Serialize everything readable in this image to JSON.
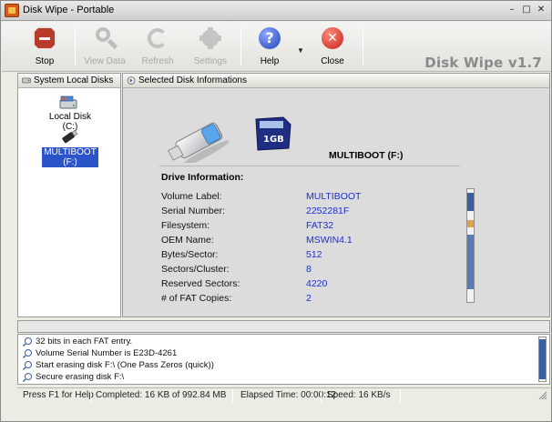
{
  "window": {
    "title": "Disk Wipe  - Portable",
    "controls": [
      "–",
      "□",
      "✕"
    ]
  },
  "toolbar": {
    "buttons": [
      {
        "label": "Stop",
        "icon": "stop-icon",
        "enabled": true
      },
      {
        "label": "View Data",
        "icon": "magnifier-icon",
        "enabled": false
      },
      {
        "label": "Refresh",
        "icon": "refresh-icon",
        "enabled": false
      },
      {
        "label": "Settings",
        "icon": "gear-icon",
        "enabled": false
      },
      {
        "label": "Help",
        "icon": "help-icon",
        "enabled": true
      },
      {
        "label": "Close",
        "icon": "close-icon",
        "enabled": true
      }
    ],
    "dropdown_glyph": "▼",
    "brand": "Disk Wipe v1.7"
  },
  "left_panel": {
    "header": "System Local Disks",
    "disks": [
      {
        "label": "Local Disk (C:)",
        "icon": "hard-drive-icon",
        "selected": false
      },
      {
        "label": "MULTIBOOT (F:)",
        "icon": "usb-drive-icon",
        "selected": true
      }
    ]
  },
  "right_panel": {
    "header": "Selected Disk Informations",
    "card_text": "1GB",
    "drive_title": "MULTIBOOT  (F:)",
    "info_heading": "Drive Information:",
    "rows": [
      {
        "label": "Volume Label:",
        "value": "MULTIBOOT"
      },
      {
        "label": "Serial Number:",
        "value": "2252281F"
      },
      {
        "label": "Filesystem:",
        "value": "FAT32"
      },
      {
        "label": "OEM Name:",
        "value": "MSWIN4.1"
      },
      {
        "label": "Bytes/Sector:",
        "value": "512"
      },
      {
        "label": "Sectors/Cluster:",
        "value": "8"
      },
      {
        "label": "Reserved Sectors:",
        "value": "4220"
      },
      {
        "label": "# of FAT Copies:",
        "value": "2"
      }
    ]
  },
  "log": {
    "lines": [
      "32 bits in each FAT entry.",
      "Volume Serial Number is E23D-4261",
      "Start erasing disk F:\\ (One Pass Zeros (quick))",
      "Secure erasing disk F:\\"
    ]
  },
  "status": {
    "help": "Press F1 for Help",
    "completed": "Completed:  16 KB of 992.84 MB",
    "elapsed": "Elapsed Time: 00:00:12",
    "speed": "Speed: 16 KB/s"
  },
  "colors": {
    "value_blue": "#1a2fd0",
    "selection": "#2b54c8",
    "accent_stop": "#b83a2a"
  }
}
